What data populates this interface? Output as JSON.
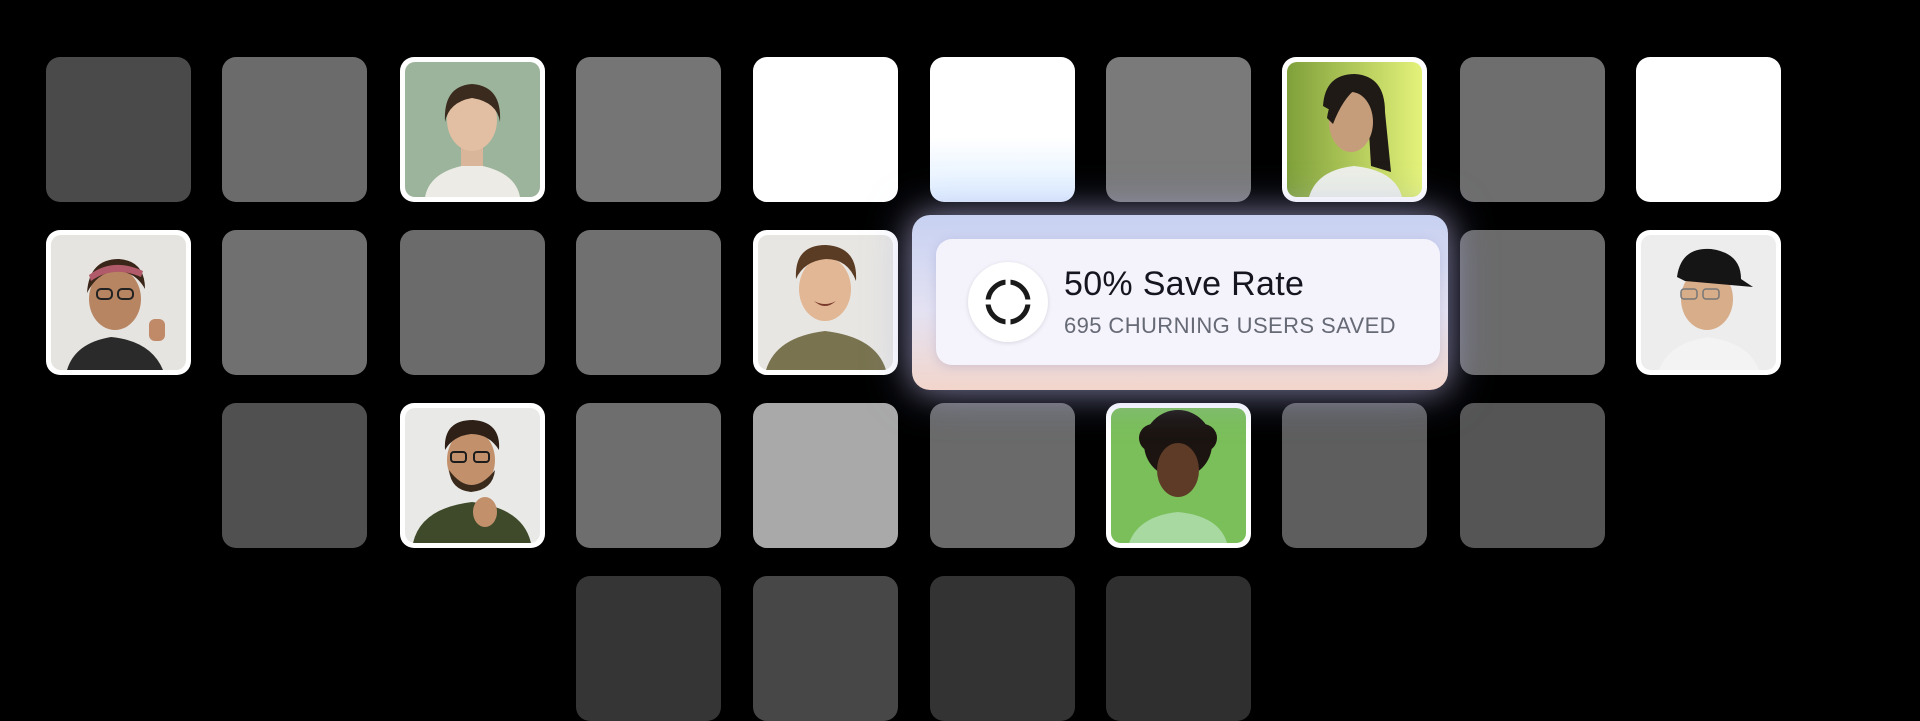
{
  "stat_card": {
    "title": "50% Save Rate",
    "subtitle": "695 CHURNING USERS SAVED",
    "icon": "ring-icon"
  },
  "colors": {
    "background": "#000000",
    "card_glow_top": "#b4c8ff",
    "card_glow_bottom": "#ffc8b4"
  }
}
